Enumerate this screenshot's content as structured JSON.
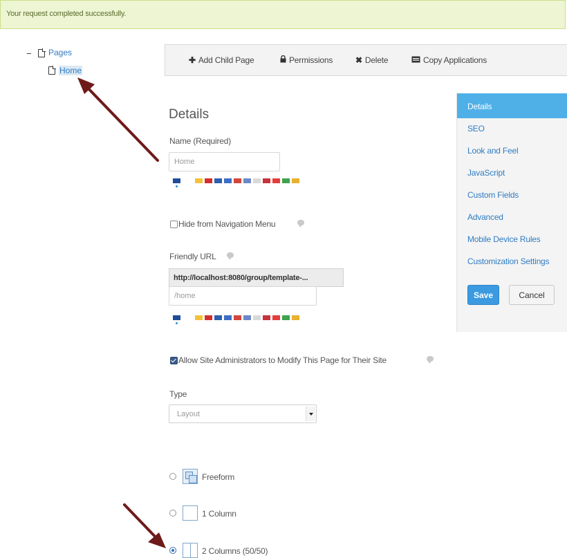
{
  "alert": {
    "message": "Your request completed successfully."
  },
  "tree": {
    "toggle": "−",
    "root_label": "Pages",
    "child_label": "Home"
  },
  "toolbar": {
    "add_child_page": "Add Child Page",
    "permissions": "Permissions",
    "delete": "Delete",
    "copy_applications": "Copy Applications"
  },
  "form": {
    "title": "Details",
    "name_label": "Name (Required)",
    "name_value": "Home",
    "hide_nav_label": "Hide from Navigation Menu",
    "hide_nav_checked": false,
    "friendly_url_label": "Friendly URL",
    "friendly_url_prefix": "http://localhost:8080/group/template-...",
    "friendly_url_value": "/home",
    "allow_admins_label": "Allow Site Administrators to Modify This Page for Their Site",
    "allow_admins_checked": true,
    "type_label": "Type",
    "type_value": "Layout",
    "layouts": [
      {
        "label": "Freeform",
        "selected": false
      },
      {
        "label": "1 Column",
        "selected": false
      },
      {
        "label": "2 Columns (50/50)",
        "selected": true
      }
    ]
  },
  "flags": [
    "#1f4d99",
    "#f3c23a",
    "#d42e2e",
    "#2e5fb0",
    "#3d6ec6",
    "#d4453a",
    "#6b88c9",
    "#d9d9d9",
    "#c9323a",
    "#e53d3d",
    "#3fa34b",
    "#e8b12e"
  ],
  "side_nav": {
    "items": [
      "Details",
      "SEO",
      "Look and Feel",
      "JavaScript",
      "Custom Fields",
      "Advanced",
      "Mobile Device Rules",
      "Customization Settings"
    ],
    "active": "Details",
    "save": "Save",
    "cancel": "Cancel"
  },
  "colors": {
    "accent": "#4fb0e8",
    "link": "#2f7cc2",
    "success_bg": "#eef5d3",
    "annotation_arrow": "#6e1a1a"
  },
  "icons": [
    "plus-icon",
    "lock-icon",
    "delete-x-icon",
    "copy-applications-icon",
    "page-icon",
    "help-bubble-icon",
    "chevron-down-icon"
  ]
}
